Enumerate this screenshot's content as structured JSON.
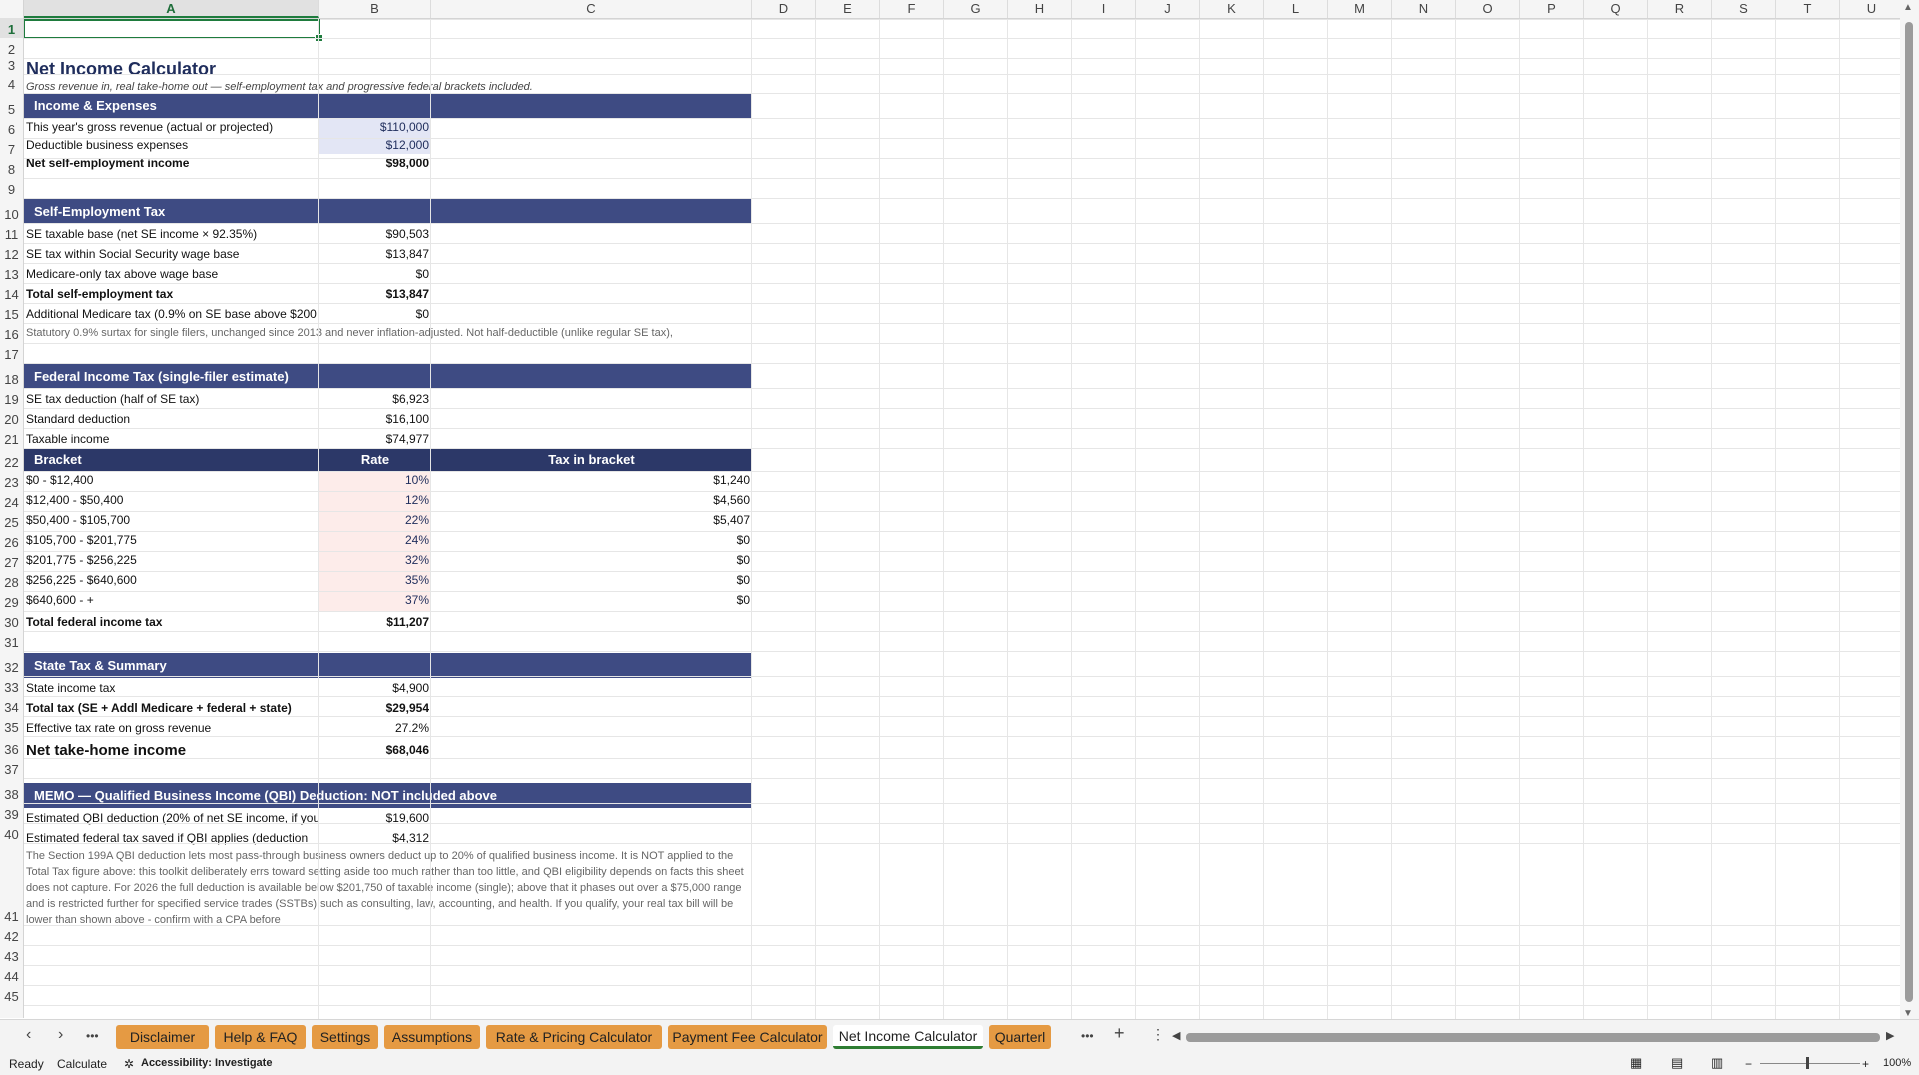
{
  "sheet": {
    "columns": [
      "A",
      "B",
      "C",
      "D",
      "E",
      "F",
      "G",
      "H",
      "I",
      "J",
      "K",
      "L",
      "M",
      "N",
      "O",
      "P",
      "Q",
      "R",
      "S",
      "T",
      "U"
    ],
    "active_column": "A",
    "active_row": 1,
    "row_numbers": [
      "1",
      "2",
      "3",
      "4",
      "5",
      "6",
      "7",
      "8",
      "9",
      "10",
      "11",
      "12",
      "13",
      "14",
      "15",
      "16",
      "17",
      "18",
      "19",
      "20",
      "21",
      "22",
      "23",
      "24",
      "25",
      "26",
      "27",
      "28",
      "29",
      "30",
      "31",
      "32",
      "33",
      "34",
      "35",
      "36",
      "37",
      "38",
      "39",
      "40",
      "41",
      "42",
      "43",
      "44",
      "45"
    ]
  },
  "title": "Net Income Calculator",
  "subtitle": "Gross revenue in, real take-home out — self-employment tax and progressive federal brackets included.",
  "income": {
    "header": "Income & Expenses",
    "rows": [
      {
        "label": "This year's gross revenue (actual or projected)",
        "value": "$110,000"
      },
      {
        "label": "Deductible business expenses",
        "value": "$12,000"
      },
      {
        "label": "Net self-employment income",
        "value": "$98,000"
      }
    ]
  },
  "se_tax": {
    "header": "Self-Employment Tax",
    "rows": [
      {
        "label": "SE taxable base (net SE income × 92.35%)",
        "value": "$90,503"
      },
      {
        "label": "SE tax within Social Security wage base",
        "value": "$13,847"
      },
      {
        "label": "Medicare-only tax above wage base",
        "value": "$0"
      },
      {
        "label": "Total self-employment tax",
        "value": "$13,847"
      },
      {
        "label": "Additional Medicare tax (0.9% on SE base above $200",
        "value": "$0"
      }
    ],
    "note": "Statutory 0.9% surtax for single filers, unchanged since 2013 and never inflation-adjusted. Not half-deductible (unlike regular SE tax),"
  },
  "federal": {
    "header": "Federal Income Tax (single-filer estimate)",
    "rows": [
      {
        "label": "SE tax deduction (half of SE tax)",
        "value": "$6,923"
      },
      {
        "label": "Standard deduction",
        "value": "$16,100"
      },
      {
        "label": "Taxable income",
        "value": "$74,977"
      }
    ],
    "bracket_headers": {
      "bracket": "Bracket",
      "rate": "Rate",
      "tax": "Tax in bracket"
    },
    "brackets": [
      {
        "bracket": "$0 - $12,400",
        "rate": "10%",
        "tax": "$1,240"
      },
      {
        "bracket": "$12,400 - $50,400",
        "rate": "12%",
        "tax": "$4,560"
      },
      {
        "bracket": "$50,400 - $105,700",
        "rate": "22%",
        "tax": "$5,407"
      },
      {
        "bracket": "$105,700 - $201,775",
        "rate": "24%",
        "tax": "$0"
      },
      {
        "bracket": "$201,775 - $256,225",
        "rate": "32%",
        "tax": "$0"
      },
      {
        "bracket": "$256,225 - $640,600",
        "rate": "35%",
        "tax": "$0"
      },
      {
        "bracket": "$640,600 - +",
        "rate": "37%",
        "tax": "$0"
      }
    ],
    "total_label": "Total federal income tax",
    "total_value": "$11,207"
  },
  "state": {
    "header": "State Tax & Summary",
    "rows": [
      {
        "label": "State income tax",
        "value": "$4,900"
      },
      {
        "label": "Total tax (SE + Addl Medicare + federal + state)",
        "value": "$29,954"
      },
      {
        "label": "Effective tax rate on gross revenue",
        "value": "27.2%"
      }
    ],
    "net_label": "Net take-home income",
    "net_value": "$68,046"
  },
  "memo": {
    "header": "MEMO — Qualified Business Income (QBI) Deduction: NOT included above",
    "rows": [
      {
        "label": "Estimated QBI deduction (20% of net SE income, if you",
        "value": "$19,600"
      },
      {
        "label": "Estimated federal tax saved if QBI applies (deduction",
        "value": "$4,312"
      }
    ],
    "note": "The Section 199A QBI deduction lets most pass-through business owners deduct up to 20% of qualified business income. It is NOT applied to the Total Tax figure above: this toolkit deliberately errs toward setting aside too much rather than too little, and QBI eligibility depends on facts this sheet does not capture. For 2026 the full deduction is available below $201,750 of taxable income (single); above that it phases out over a $75,000 range and is restricted further for specified service trades (SSTBs) such as consulting, law, accounting, and health. If you qualify, your real tax bill will be lower than shown above - confirm with a CPA before"
  },
  "tabs": {
    "items": [
      "Disclaimer",
      "Help & FAQ",
      "Settings",
      "Assumptions",
      "Rate & Pricing Calculator",
      "Payment Fee Calculator",
      "Net Income Calculator",
      "Quarterl"
    ],
    "active": "Net Income Calculator",
    "more": "•••",
    "add": "+",
    "menu": "⋮"
  },
  "status": {
    "ready": "Ready",
    "calculate": "Calculate",
    "accessibility": "Accessibility: Investigate",
    "zoom": "100%"
  },
  "colors": {
    "band": "#3e4b83",
    "tab_orange": "#e59a43",
    "accent_green": "#1e7b3d"
  }
}
